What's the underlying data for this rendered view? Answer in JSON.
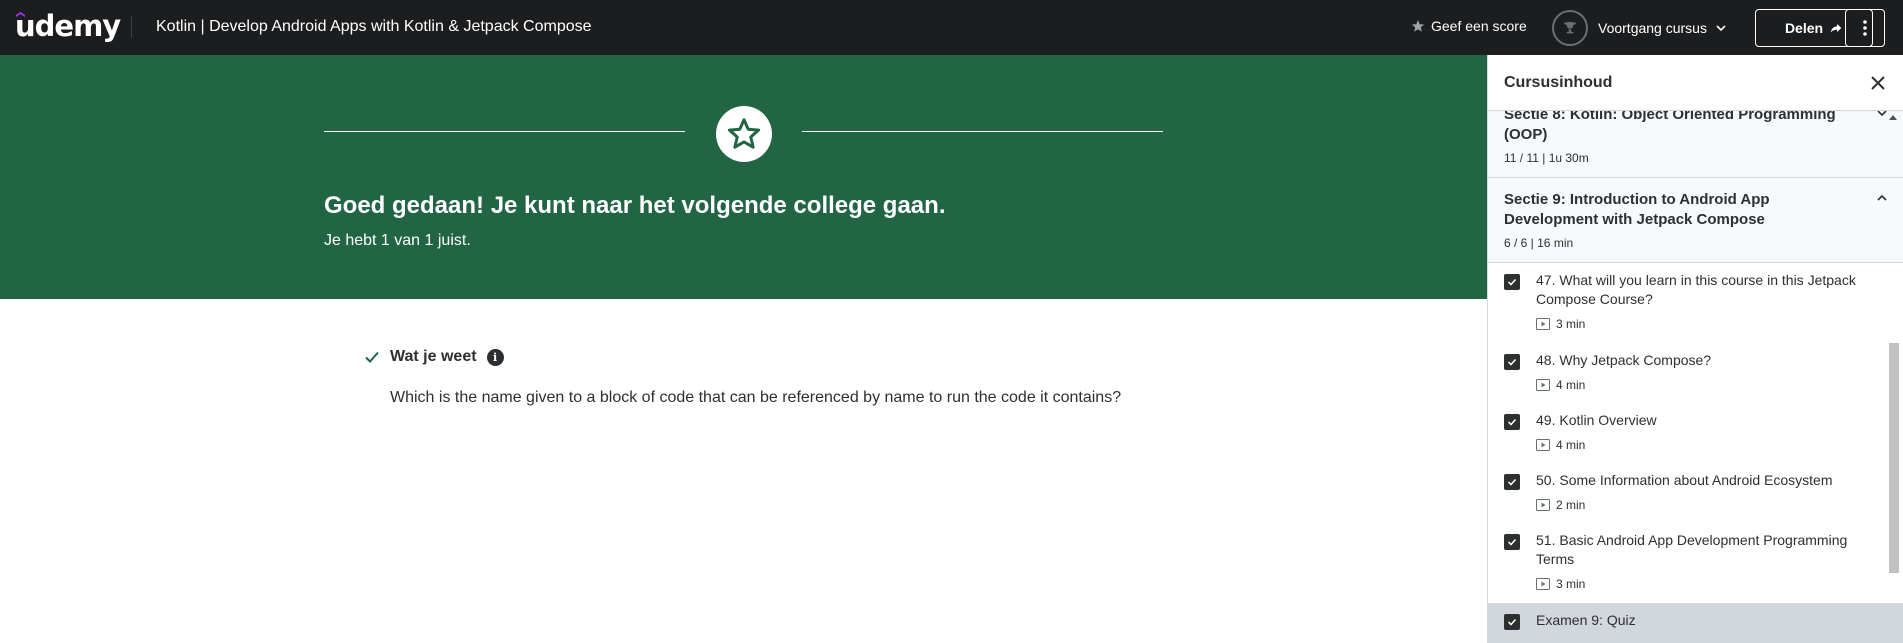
{
  "header": {
    "logo": "udemy",
    "course_title": "Kotlin | Develop Android Apps with Kotlin & Jetpack Compose",
    "rate_label": "Geef een score",
    "progress_label": "Voortgang cursus",
    "share_label": "Delen"
  },
  "banner": {
    "title": "Goed gedaan! Je kunt naar het volgende college gaan.",
    "subtitle": "Je hebt 1 van 1 juist."
  },
  "main": {
    "know_label": "Wat je weet",
    "question": "Which is the name given to a block of code that can be referenced by name to run the code it contains?"
  },
  "sidebar": {
    "title": "Cursusinhoud",
    "sections": [
      {
        "title": "Sectie 8: Kotlin: Object Oriented Programming (OOP)",
        "meta": "11 / 11 | 1u 30m"
      },
      {
        "title": "Sectie 9: Introduction to Android App Development with Jetpack Compose",
        "meta": "6 / 6 | 16 min"
      }
    ],
    "items": [
      {
        "title": "47. What will you learn in this course in this Jetpack Compose Course?",
        "duration": "3 min"
      },
      {
        "title": "48. Why Jetpack Compose?",
        "duration": "4 min"
      },
      {
        "title": "49. Kotlin Overview",
        "duration": "4 min"
      },
      {
        "title": "50. Some Information about Android Ecosystem",
        "duration": "2 min"
      },
      {
        "title": "51. Basic Android App Development Programming Terms",
        "duration": "3 min"
      },
      {
        "title": "Examen 9: Quiz",
        "duration": ""
      }
    ]
  },
  "colors": {
    "header_bg": "#1c1d1f",
    "banner_bg": "#216544",
    "text": "#2d2f31",
    "active_item_bg": "#d1d7dc"
  }
}
